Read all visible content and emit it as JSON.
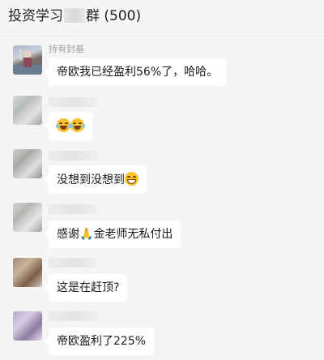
{
  "header": {
    "title_prefix": "投资学习",
    "title_suffix": "群 (500)"
  },
  "messages": [
    {
      "sender": "持有封基",
      "text": "帝欧我已经盈利56%了，哈哈。"
    },
    {
      "sender": "",
      "text": "",
      "emoji": [
        "tears-of-joy-emoji",
        "tears-of-joy-emoji"
      ]
    },
    {
      "sender": "",
      "text": "没想到没想到",
      "emoji": [
        "grinning-face-emoji"
      ]
    },
    {
      "sender": "",
      "text_before": "感谢",
      "emoji": [
        "folded-hands-emoji"
      ],
      "text_after": "金老师无私付出"
    },
    {
      "sender": "",
      "text": "这是在赶顶?"
    },
    {
      "sender": "",
      "text": "帝欧盈利了225%"
    }
  ]
}
